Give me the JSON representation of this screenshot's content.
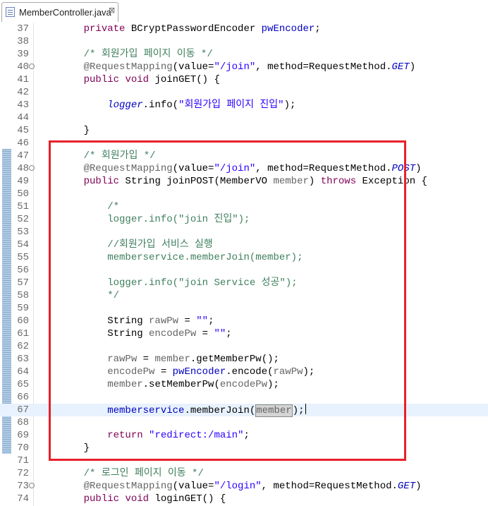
{
  "tab": {
    "title": "MemberController.java",
    "close_glyph": "⊠"
  },
  "colors": {
    "keyword": "#7f0055",
    "comment": "#3f7f5f",
    "string": "#2a00ff",
    "annotation": "#646464",
    "field": "#0000c0",
    "highlight_box": "#e8202a",
    "current_line": "#e8f2fe"
  },
  "current_line": 67,
  "highlight_box": {
    "from_line": 47,
    "to_line": 70
  },
  "lines": [
    {
      "n": "37",
      "fold": "",
      "tokens": [
        [
          "    ",
          ""
        ],
        [
          "private",
          "kw"
        ],
        [
          " BCryptPasswordEncoder ",
          ""
        ],
        [
          "pwEncoder",
          "fd"
        ],
        [
          ";",
          ""
        ]
      ]
    },
    {
      "n": "38",
      "fold": "",
      "tokens": []
    },
    {
      "n": "39",
      "fold": "",
      "tokens": [
        [
          "    ",
          ""
        ],
        [
          "/* 회원가입 페이지 이동 */",
          "cm"
        ]
      ]
    },
    {
      "n": "40",
      "fold": "⊖",
      "tokens": [
        [
          "    ",
          ""
        ],
        [
          "@RequestMapping",
          "an"
        ],
        [
          "(value=",
          ""
        ],
        [
          "\"/join\"",
          "st"
        ],
        [
          ", method=RequestMethod.",
          ""
        ],
        [
          "GET",
          "fd it"
        ],
        [
          ")",
          ""
        ]
      ]
    },
    {
      "n": "41",
      "fold": "",
      "tokens": [
        [
          "    ",
          ""
        ],
        [
          "public",
          "kw"
        ],
        [
          " ",
          ""
        ],
        [
          "void",
          "kw"
        ],
        [
          " joinGET() {",
          ""
        ]
      ]
    },
    {
      "n": "42",
      "fold": "",
      "tokens": []
    },
    {
      "n": "43",
      "fold": "",
      "tokens": [
        [
          "        ",
          ""
        ],
        [
          "logger",
          "fd it"
        ],
        [
          ".info(",
          ""
        ],
        [
          "\"회원가입 페이지 진입\"",
          "st"
        ],
        [
          ");",
          ""
        ]
      ]
    },
    {
      "n": "44",
      "fold": "",
      "tokens": []
    },
    {
      "n": "45",
      "fold": "",
      "tokens": [
        [
          "    }",
          ""
        ]
      ]
    },
    {
      "n": "46",
      "fold": "",
      "tokens": []
    },
    {
      "n": "47",
      "fold": "",
      "tokens": [
        [
          "    ",
          ""
        ],
        [
          "/* 회원가입 */",
          "cm"
        ]
      ]
    },
    {
      "n": "48",
      "fold": "⊖",
      "tokens": [
        [
          "    ",
          ""
        ],
        [
          "@RequestMapping",
          "an"
        ],
        [
          "(value=",
          ""
        ],
        [
          "\"/join\"",
          "st"
        ],
        [
          ", method=RequestMethod.",
          ""
        ],
        [
          "POST",
          "fd it"
        ],
        [
          ")",
          ""
        ]
      ]
    },
    {
      "n": "49",
      "fold": "",
      "tokens": [
        [
          "    ",
          ""
        ],
        [
          "public",
          "kw"
        ],
        [
          " String joinPOST(MemberVO ",
          ""
        ],
        [
          "member",
          "an"
        ],
        [
          ") ",
          ""
        ],
        [
          "throws",
          "kw"
        ],
        [
          " Exception {",
          ""
        ]
      ]
    },
    {
      "n": "50",
      "fold": "",
      "tokens": []
    },
    {
      "n": "51",
      "fold": "",
      "tokens": [
        [
          "        ",
          ""
        ],
        [
          "/*",
          "cm"
        ]
      ]
    },
    {
      "n": "52",
      "fold": "",
      "tokens": [
        [
          "        ",
          ""
        ],
        [
          "logger.info(\"join 진입\");",
          "cm"
        ]
      ]
    },
    {
      "n": "53",
      "fold": "",
      "tokens": []
    },
    {
      "n": "54",
      "fold": "",
      "tokens": [
        [
          "        ",
          ""
        ],
        [
          "//회원가입 서비스 실행",
          "cm"
        ]
      ]
    },
    {
      "n": "55",
      "fold": "",
      "tokens": [
        [
          "        ",
          ""
        ],
        [
          "memberservice.memberJoin(member);",
          "cm"
        ]
      ]
    },
    {
      "n": "56",
      "fold": "",
      "tokens": []
    },
    {
      "n": "57",
      "fold": "",
      "tokens": [
        [
          "        ",
          ""
        ],
        [
          "logger.info(\"join Service 성공\");",
          "cm"
        ]
      ]
    },
    {
      "n": "58",
      "fold": "",
      "tokens": [
        [
          "        ",
          ""
        ],
        [
          "*/",
          "cm"
        ]
      ]
    },
    {
      "n": "59",
      "fold": "",
      "tokens": []
    },
    {
      "n": "60",
      "fold": "",
      "tokens": [
        [
          "        String ",
          ""
        ],
        [
          "rawPw",
          "an"
        ],
        [
          " = ",
          ""
        ],
        [
          "\"\"",
          "st"
        ],
        [
          ";",
          ""
        ]
      ]
    },
    {
      "n": "61",
      "fold": "",
      "tokens": [
        [
          "        String ",
          ""
        ],
        [
          "encodePw",
          "an"
        ],
        [
          " = ",
          ""
        ],
        [
          "\"\"",
          "st"
        ],
        [
          ";",
          ""
        ]
      ]
    },
    {
      "n": "62",
      "fold": "",
      "tokens": []
    },
    {
      "n": "63",
      "fold": "",
      "tokens": [
        [
          "        ",
          ""
        ],
        [
          "rawPw",
          "an"
        ],
        [
          " = ",
          ""
        ],
        [
          "member",
          "an"
        ],
        [
          ".getMemberPw();",
          ""
        ]
      ]
    },
    {
      "n": "64",
      "fold": "",
      "tokens": [
        [
          "        ",
          ""
        ],
        [
          "encodePw",
          "an"
        ],
        [
          " = ",
          ""
        ],
        [
          "pwEncoder",
          "fd"
        ],
        [
          ".encode(",
          ""
        ],
        [
          "rawPw",
          "an"
        ],
        [
          ");",
          ""
        ]
      ]
    },
    {
      "n": "65",
      "fold": "",
      "tokens": [
        [
          "        ",
          ""
        ],
        [
          "member",
          "an"
        ],
        [
          ".setMemberPw(",
          ""
        ],
        [
          "encodePw",
          "an"
        ],
        [
          ");",
          ""
        ]
      ]
    },
    {
      "n": "66",
      "fold": "",
      "tokens": []
    },
    {
      "n": "67",
      "fold": "",
      "tokens": [
        [
          "        ",
          ""
        ],
        [
          "memberservice",
          "fd"
        ],
        [
          ".memberJoin(",
          ""
        ],
        [
          "member",
          "an occ"
        ],
        [
          ");",
          ""
        ]
      ]
    },
    {
      "n": "68",
      "fold": "",
      "tokens": []
    },
    {
      "n": "69",
      "fold": "",
      "tokens": [
        [
          "        ",
          ""
        ],
        [
          "return",
          "kw"
        ],
        [
          " ",
          ""
        ],
        [
          "\"redirect:/main\"",
          "st"
        ],
        [
          ";",
          ""
        ]
      ]
    },
    {
      "n": "70",
      "fold": "",
      "tokens": [
        [
          "    }",
          ""
        ]
      ]
    },
    {
      "n": "71",
      "fold": "",
      "tokens": []
    },
    {
      "n": "72",
      "fold": "",
      "tokens": [
        [
          "    ",
          ""
        ],
        [
          "/* 로그인 페이지 이동 */",
          "cm"
        ]
      ]
    },
    {
      "n": "73",
      "fold": "⊖",
      "tokens": [
        [
          "    ",
          ""
        ],
        [
          "@RequestMapping",
          "an"
        ],
        [
          "(value=",
          ""
        ],
        [
          "\"/login\"",
          "st"
        ],
        [
          ", method=RequestMethod.",
          ""
        ],
        [
          "GET",
          "fd it"
        ],
        [
          ")",
          ""
        ]
      ]
    },
    {
      "n": "74",
      "fold": "",
      "tokens": [
        [
          "    ",
          ""
        ],
        [
          "public",
          "kw"
        ],
        [
          " ",
          ""
        ],
        [
          "void",
          "kw"
        ],
        [
          " loginGET() {",
          ""
        ]
      ]
    }
  ]
}
